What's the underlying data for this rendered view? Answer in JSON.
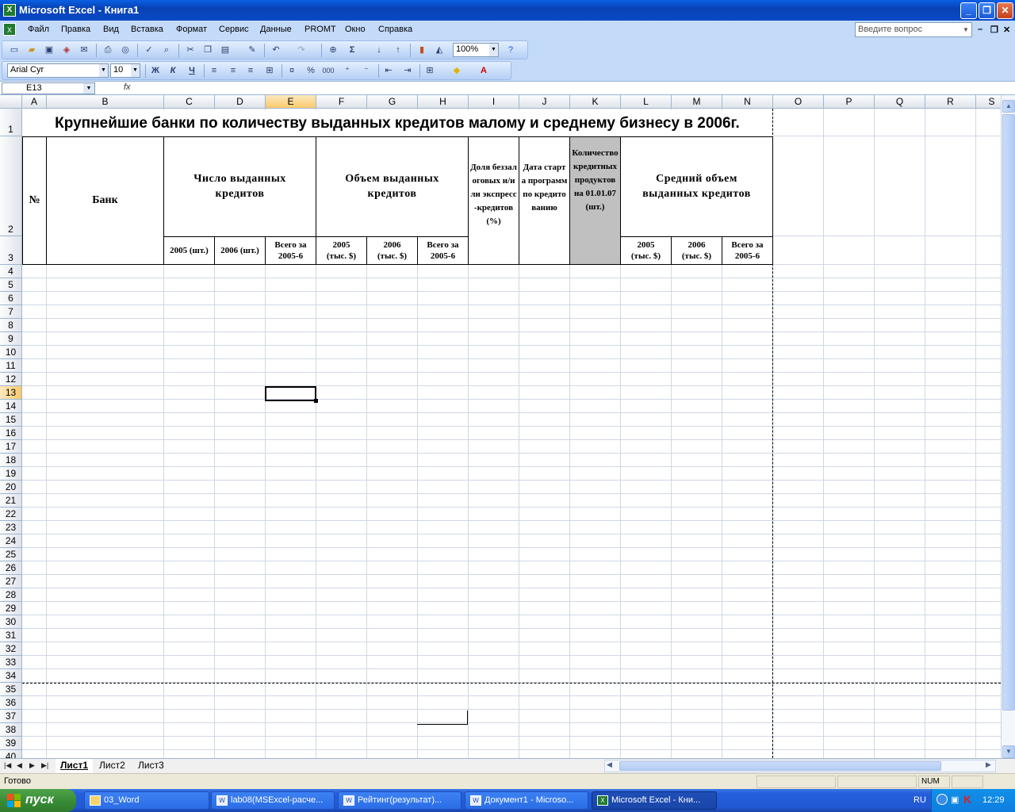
{
  "window": {
    "title": "Microsoft Excel - Книга1",
    "minimize": "_",
    "restore": "❐",
    "close": "✕"
  },
  "menu": [
    "Файл",
    "Правка",
    "Вид",
    "Вставка",
    "Формат",
    "Сервис",
    "Данные",
    "PROMT",
    "Окно",
    "Справка"
  ],
  "help_placeholder": "Введите вопрос",
  "toolbar": {
    "zoom": "100%",
    "font_name": "Arial Cyr",
    "font_size": "10",
    "bold": "Ж",
    "italic": "К",
    "underline": "Ч",
    "autosum": "Σ",
    "percent": "%",
    "thousands": "000"
  },
  "formula_bar": {
    "name_box": "E13",
    "fx": "fx",
    "content": ""
  },
  "columns": [
    "A",
    "B",
    "C",
    "D",
    "E",
    "F",
    "G",
    "H",
    "I",
    "J",
    "K",
    "L",
    "M",
    "N",
    "O",
    "P",
    "Q",
    "R",
    "S"
  ],
  "active_column": "E",
  "active_row": "13",
  "rows_visible": [
    "1",
    "2",
    "3",
    "4",
    "5",
    "6",
    "7",
    "8",
    "9",
    "10",
    "11",
    "12",
    "13",
    "14",
    "15",
    "16",
    "17",
    "18",
    "19",
    "20",
    "21",
    "22",
    "23",
    "24",
    "25",
    "26",
    "27",
    "28",
    "29",
    "30",
    "31",
    "32",
    "33",
    "34",
    "35",
    "36",
    "37",
    "38",
    "39",
    "40"
  ],
  "sheet": {
    "title": "Крупнейшие банки по количеству выданных кредитов малому и среднему бизнесу в 2006г.",
    "header": {
      "num": "№",
      "bank": "Банк",
      "count_group": "Число выданных кредитов",
      "volume_group": "Объем выданных кредитов",
      "share": "Доля беззалоговых и/или экспресс-кредитов (%)",
      "start_date": "Дата старта программ по кредитованию",
      "products": "Количество кредитных продуктов на 01.01.07 (шт.)",
      "avg_group": "Средний объем выданных кредитов",
      "count_2005": "2005 (шт.)",
      "count_2006": "2006 (шт.)",
      "count_total": "Всего за 2005-6",
      "vol_2005": "2005 (тыс. $)",
      "vol_2006": "2006 (тыс. $)",
      "vol_total": "Всего за 2005-6",
      "avg_2005": "2005 (тыс. $)",
      "avg_2006": "2006 (тыс. $)",
      "avg_total": "Всего за 2005-6"
    }
  },
  "sheet_tabs": [
    "Лист1",
    "Лист2",
    "Лист3"
  ],
  "status": {
    "ready": "Готово",
    "num": "NUM"
  },
  "taskbar": {
    "start": "пуск",
    "tasks": [
      "03_Word",
      "lab08(MSExcel-расче...",
      "Рейтинг(результат)...",
      "Документ1 - Microso...",
      "Microsoft Excel - Кни..."
    ],
    "lang": "RU",
    "clock": "12:29"
  },
  "colors": {
    "title_blue": "#0a4ac8",
    "toolbar_blue": "#c3daf9",
    "grey_header_cell": "#c0c0c0",
    "selected_header": "#f9c96b",
    "taskbar_green": "#3a8d37"
  }
}
